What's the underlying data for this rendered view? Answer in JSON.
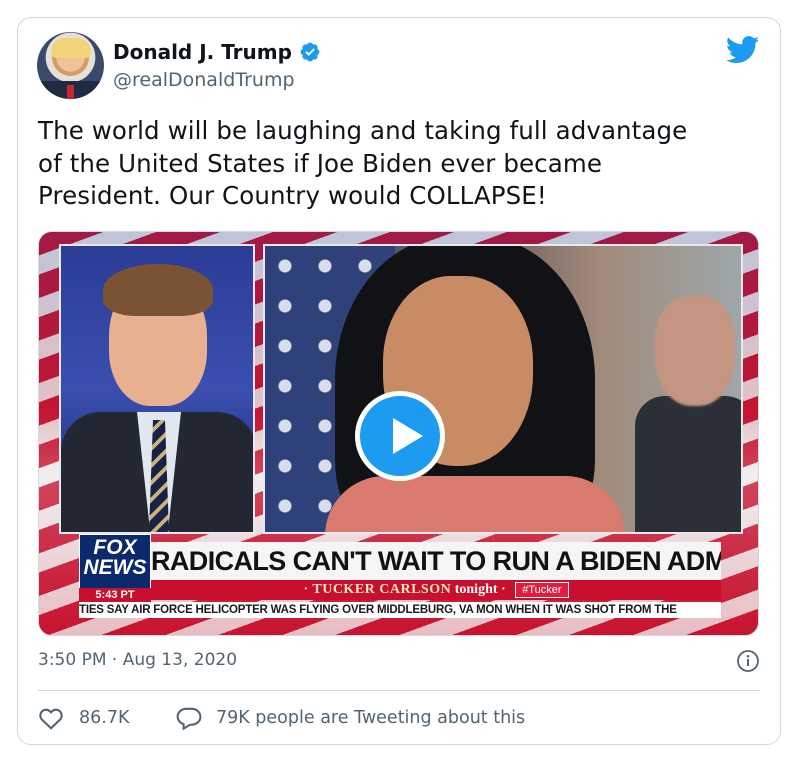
{
  "author": {
    "name": "Donald J. Trump",
    "handle": "@realDonaldTrump",
    "verified_icon": "verified-badge-icon",
    "avatar": "profile-photo"
  },
  "brand": {
    "icon": "twitter-bird-icon",
    "color": "#1d9bf0"
  },
  "tweet": {
    "lines": [
      "The world will be laughing and taking full advantage",
      "of the United States if Joe Biden ever became",
      "President. Our Country would COLLAPSE!"
    ]
  },
  "video": {
    "play_icon": "play-icon",
    "network_logo_line1": "FOX",
    "network_logo_line2": "NEWS",
    "clock": "5:43 PT",
    "headline": "RADICALS CAN'T WAIT TO RUN A BIDEN ADMINISTRATION",
    "program": "· TUCKER CARLSON",
    "program_suffix": "tonight ·",
    "hashtag": "#Tucker",
    "ticker": "TIES SAY AIR FORCE HELICOPTER WAS FLYING OVER MIDDLEBURG, VA MON WHEN IT WAS SHOT FROM THE"
  },
  "meta": {
    "timestamp": "3:50 PM · Aug 13, 2020",
    "info_icon": "info-icon"
  },
  "stats": {
    "likes": "86.7K",
    "like_icon": "heart-icon",
    "reply_icon": "speech-bubble-icon",
    "tweeting": "79K people are Tweeting about this"
  },
  "colors": {
    "text_primary": "#0f1419",
    "text_secondary": "#536471",
    "border": "#cfd9de",
    "fox_red": "#c8102e",
    "fox_blue": "#0b2a6b"
  }
}
